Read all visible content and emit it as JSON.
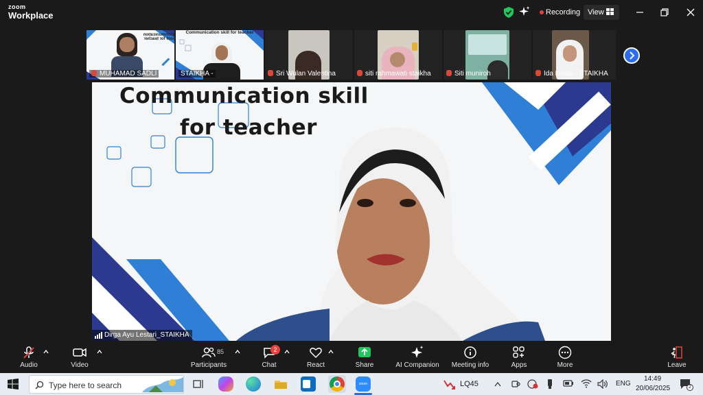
{
  "app": {
    "logo_top": "zoom",
    "logo_bottom": "Workplace"
  },
  "titlebar": {
    "recording_label": "Recording",
    "view_label": "View"
  },
  "thumbnails": [
    {
      "name": "MUHAMAD SADLI"
    },
    {
      "name": "STAIKHA -"
    },
    {
      "name": "Sri Wulan Valentina"
    },
    {
      "name": "siti rahmawati staikha"
    },
    {
      "name": "Siti muniroh"
    },
    {
      "name": "Ida Nudia - STAIKHA"
    }
  ],
  "thumb_slide": {
    "title_mirrored": "Communication skill for teacher",
    "title": "Communication skill for teacher"
  },
  "main_video": {
    "slide_line1": "Communication skill",
    "slide_line2": "for teacher",
    "participant_name": "Dirga Ayu Lestari_STAIKHA"
  },
  "toolbar": {
    "audio": "Audio",
    "video": "Video",
    "participants": "Participants",
    "participants_count": "85",
    "chat": "Chat",
    "chat_badge": "2",
    "react": "React",
    "share": "Share",
    "ai_companion": "AI Companion",
    "meeting_info": "Meeting info",
    "apps": "Apps",
    "more": "More",
    "leave": "Leave"
  },
  "taskbar": {
    "search_placeholder": "Type here to search",
    "stock": "LQ45",
    "language": "ENG",
    "time": "14:49",
    "date": "20/06/2025",
    "notification_count": "2"
  },
  "colors": {
    "accent_blue": "#2c6cf0",
    "share_green": "#23c55e",
    "recording_red": "#e8413b",
    "slide_blue": "#2f7fd6"
  }
}
